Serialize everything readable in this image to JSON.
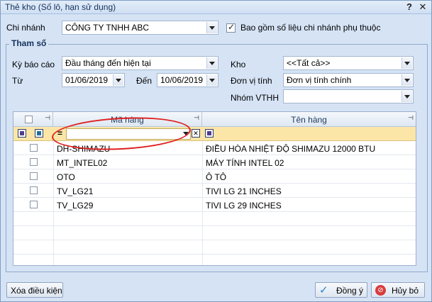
{
  "window": {
    "title": "Thẻ kho (Số lô, hạn sử dụng)",
    "help": "?",
    "close": "✕"
  },
  "branch": {
    "label": "Chi nhánh",
    "value": "CÔNG TY TNHH ABC",
    "include_label": "Bao gồm số liệu chi nhánh phụ thuộc",
    "include_checked": true
  },
  "params": {
    "group_title": "Tham số",
    "period_label": "Kỳ báo cáo",
    "period_value": "Đầu tháng đến hiện tại",
    "from_label": "Từ",
    "from_value": "01/06/2019",
    "to_label": "Đến",
    "to_value": "10/06/2019",
    "warehouse_label": "Kho",
    "warehouse_value": "<<Tất cả>>",
    "unit_label": "Đơn vị tính",
    "unit_value": "Đơn vị tính chính",
    "group_label": "Nhóm VTHH",
    "group_value": ""
  },
  "grid": {
    "columns": [
      "Mã hàng",
      "Tên hàng"
    ],
    "filter_operator": "=",
    "rows": [
      {
        "code": "DH-SHIMAZU",
        "name": "ĐIỀU HÒA NHIỆT ĐỘ SHIMAZU 12000 BTU"
      },
      {
        "code": "MT_INTEL02",
        "name": "MÁY TÍNH INTEL 02"
      },
      {
        "code": "OTO",
        "name": "Ô TÔ"
      },
      {
        "code": "TV_LG21",
        "name": "TIVI LG 21 INCHES"
      },
      {
        "code": "TV_LG29",
        "name": "TIVI LG 29 INCHES"
      }
    ]
  },
  "footer": {
    "clear_label": "Xóa điều kiện",
    "ok_label": "Đồng ý",
    "cancel_label": "Hủy bỏ"
  },
  "colors": {
    "annotation": "#e0201f",
    "filter_row": "#fbe6a8",
    "accent": "#15325c"
  }
}
